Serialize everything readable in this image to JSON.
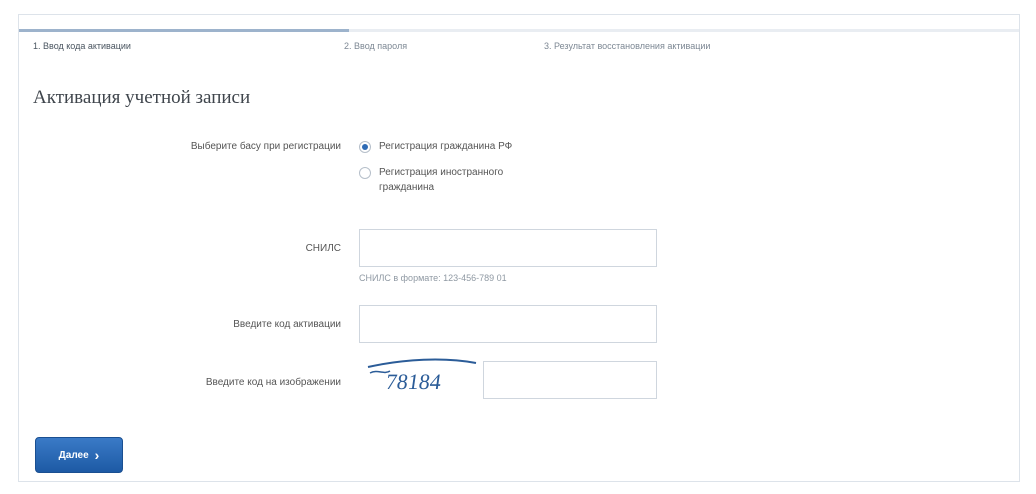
{
  "steps": [
    {
      "label": "1. Ввод кода активации",
      "active": true
    },
    {
      "label": "2. Ввод пароля",
      "active": false
    },
    {
      "label": "3. Результат восстановления активации",
      "active": false
    }
  ],
  "progress": 0.33,
  "title": "Активация учетной записи",
  "registration": {
    "label": "Выберите басу при регистрации",
    "options": [
      {
        "label": "Регистрация гражданина РФ",
        "checked": true
      },
      {
        "label": "Регистрация иностранного гражданина",
        "checked": false
      }
    ]
  },
  "snils": {
    "label": "СНИЛС",
    "value": "",
    "hint": "СНИЛС в формате: 123-456-789 01"
  },
  "activation_code": {
    "label": "Введите код активации",
    "value": ""
  },
  "captcha": {
    "label": "Введите код на изображении",
    "image_text": "78184",
    "value": ""
  },
  "next_button": {
    "label": "Далее",
    "icon": "chevron-right-icon"
  },
  "colors": {
    "accent": "#1d5aa5",
    "radio_checked": "#2e6bb5",
    "captcha_text": "#2b5c98"
  }
}
